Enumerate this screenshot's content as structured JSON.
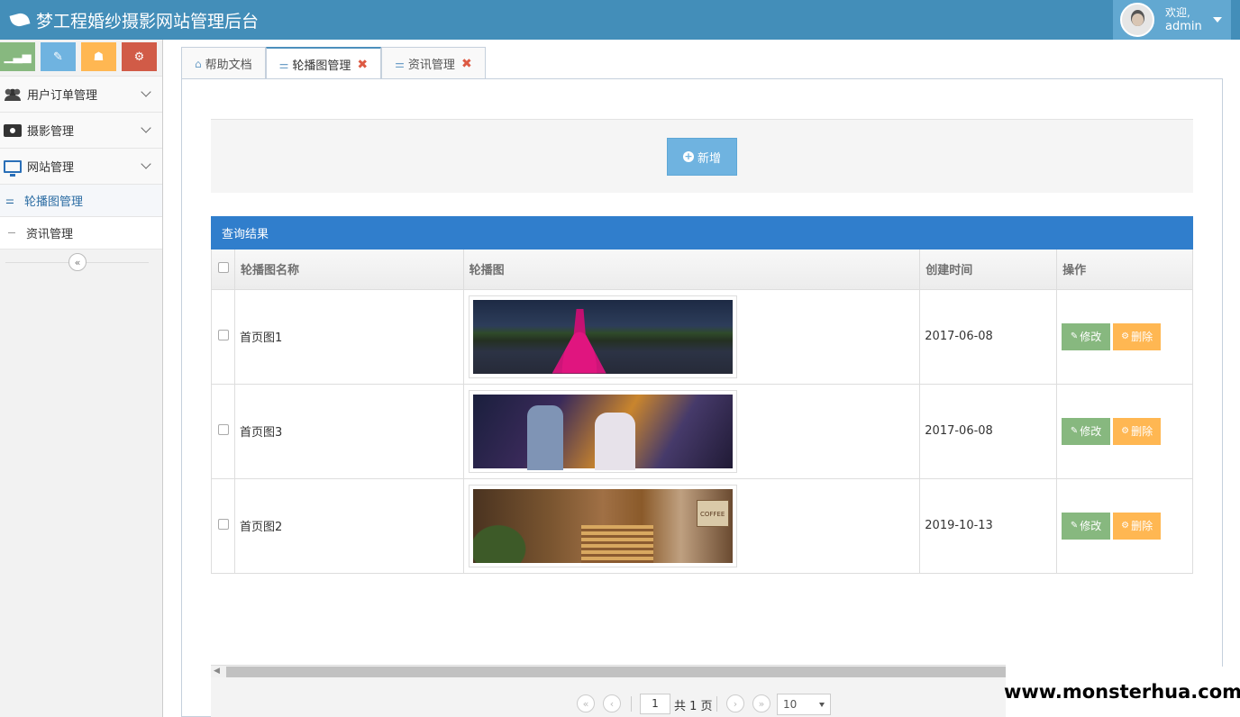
{
  "app": {
    "title": "梦工程婚纱摄影网站管理后台"
  },
  "user": {
    "welcome": "欢迎,",
    "name": "admin"
  },
  "shortcuts": [
    {
      "icon": "signal-icon",
      "color": "#87b87f"
    },
    {
      "icon": "pencil-icon",
      "color": "#6fb3e0"
    },
    {
      "icon": "users-icon",
      "color": "#ffb752"
    },
    {
      "icon": "cogs-icon",
      "color": "#d15b47"
    }
  ],
  "sidebar": {
    "items": [
      {
        "label": "用户订单管理",
        "icon": "users-icon"
      },
      {
        "label": "摄影管理",
        "icon": "camera-icon"
      },
      {
        "label": "网站管理",
        "icon": "desktop-icon"
      }
    ],
    "subitems": [
      {
        "label": "轮播图管理",
        "active": true
      },
      {
        "label": "资讯管理",
        "active": false
      }
    ]
  },
  "tabs": [
    {
      "label": "帮助文档",
      "icon": "home-icon",
      "closable": false
    },
    {
      "label": "轮播图管理",
      "icon": "sliders-icon",
      "closable": true,
      "active": true
    },
    {
      "label": "资讯管理",
      "icon": "sliders-icon",
      "closable": true
    }
  ],
  "toolbar": {
    "add_label": "新增"
  },
  "results": {
    "title": "查询结果",
    "columns": [
      "轮播图名称",
      "轮播图",
      "创建时间",
      "操作"
    ],
    "rows": [
      {
        "name": "首页图1",
        "date": "2017-06-08"
      },
      {
        "name": "首页图3",
        "date": "2017-06-08"
      },
      {
        "name": "首页图2",
        "date": "2019-10-13"
      }
    ],
    "edit_label": "修改",
    "delete_label": "删除"
  },
  "pager": {
    "page": "1",
    "total_text": "共 1 页",
    "page_size": "10"
  },
  "watermark": "www.monsterhua.com",
  "colors": {
    "navbar": "#438eb9",
    "result_header": "#307ecc",
    "edit": "#87b87f",
    "delete": "#ffb752",
    "add": "#6fb3e0"
  }
}
